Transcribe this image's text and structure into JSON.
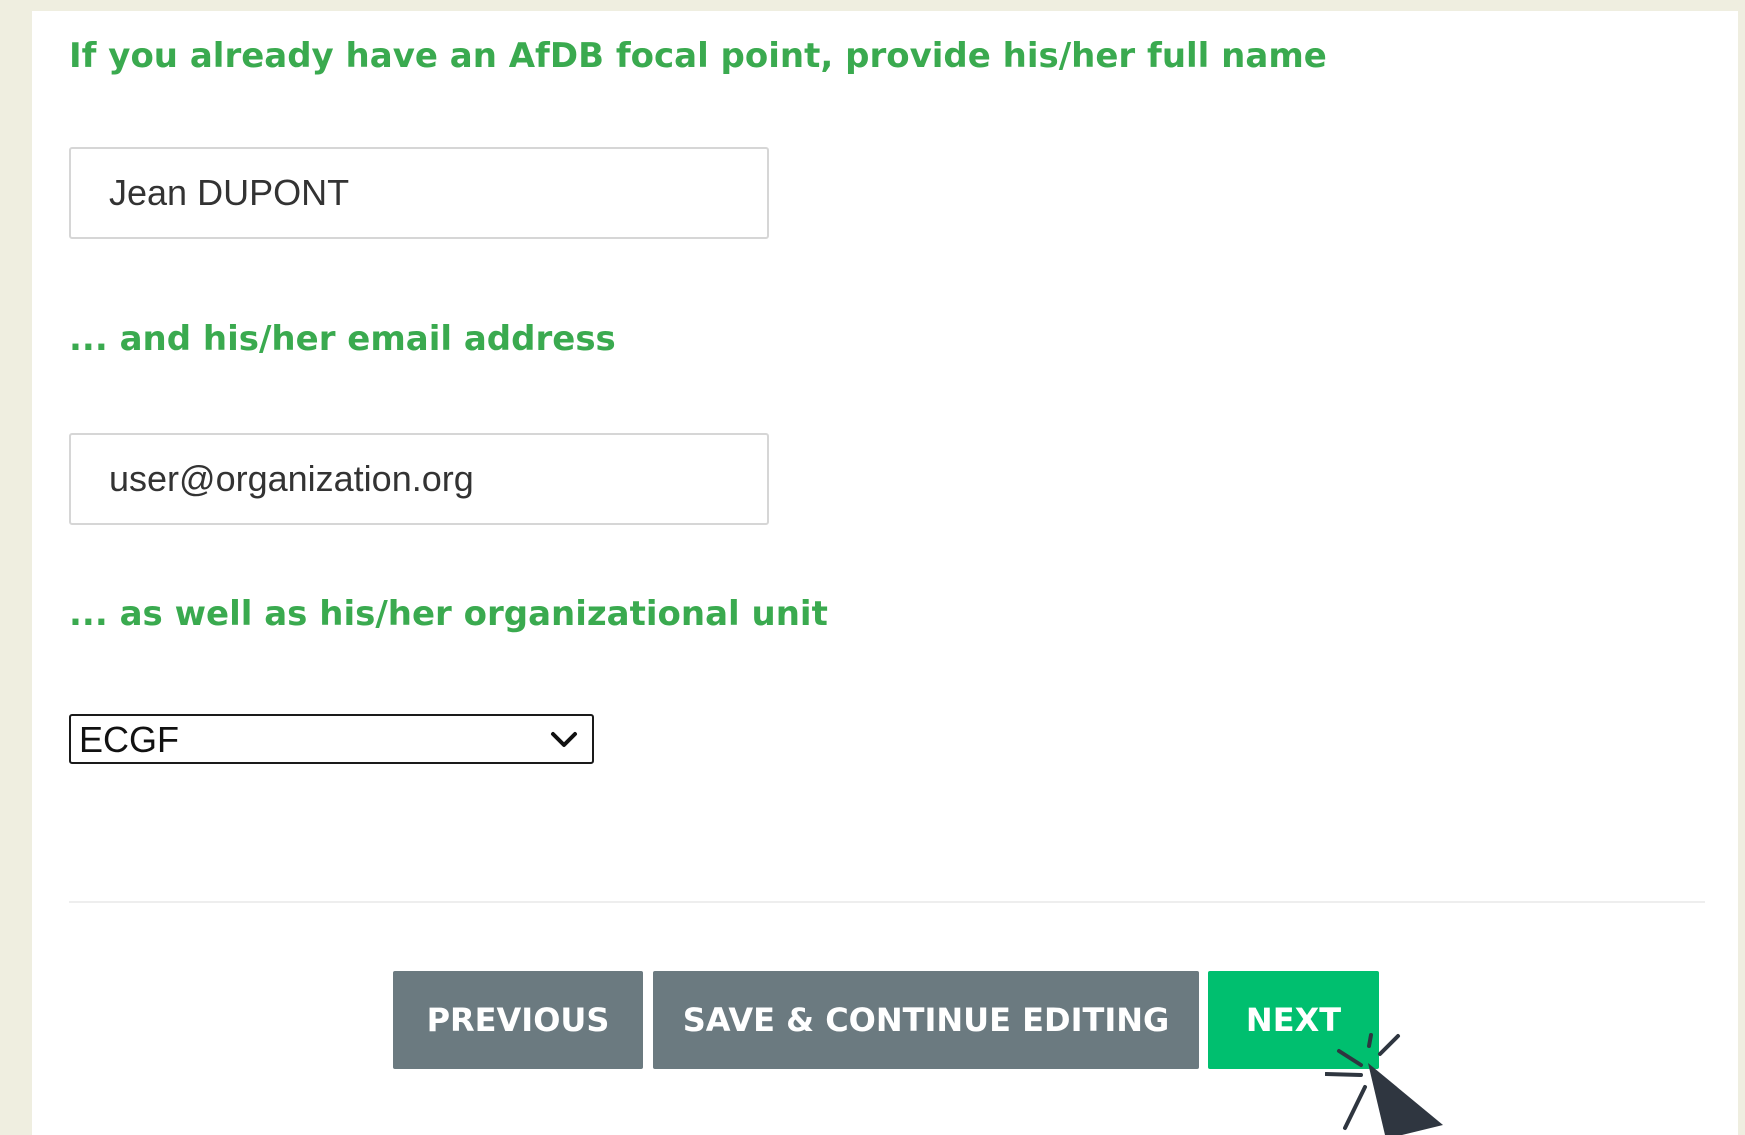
{
  "form": {
    "q1_label": "If you already have an AfDB focal point, provide his/her full name",
    "q1_value": "Jean DUPONT",
    "q2_label": "... and his/her email address",
    "q2_value": "user@organization.org",
    "q3_label": "... as well as his/her organizational unit",
    "q3_selected": "ECGF"
  },
  "buttons": {
    "previous": "PREVIOUS",
    "save": "SAVE & CONTINUE EDITING",
    "next": "NEXT"
  },
  "colors": {
    "page_background": "#efeee0",
    "question_text": "#3aaa4f",
    "secondary_button": "#6b7a80",
    "primary_button": "#00bf6f"
  },
  "icons": {
    "select_arrow": "chevron-down-icon",
    "pointer": "cursor-click-icon"
  }
}
